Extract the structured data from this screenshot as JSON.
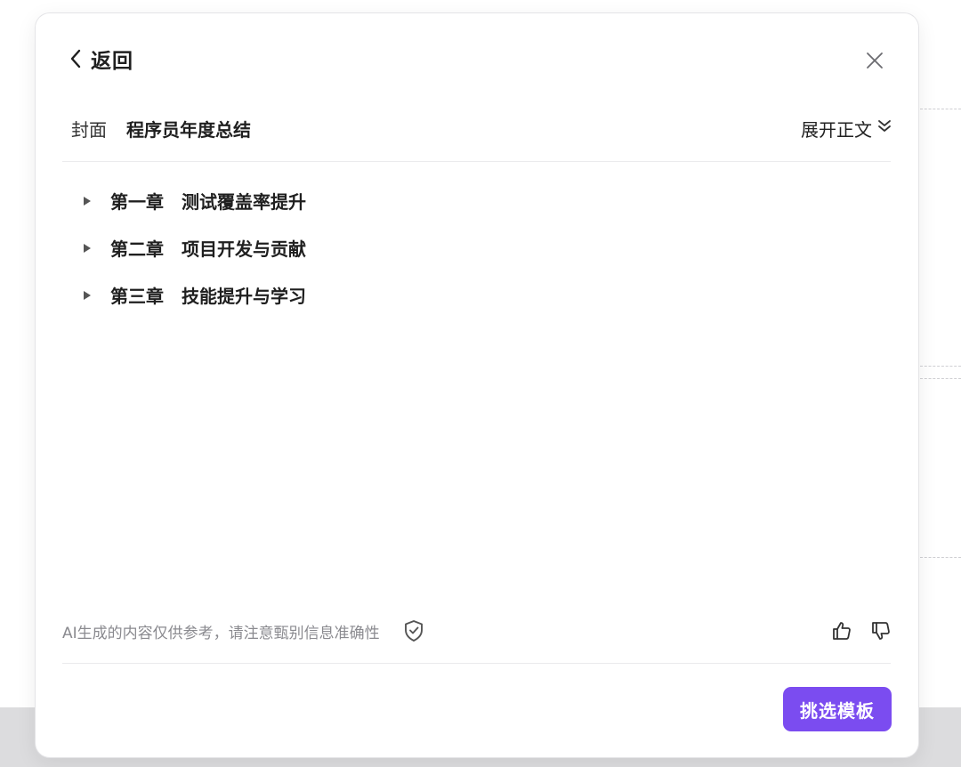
{
  "header": {
    "back_label": "返回"
  },
  "cover": {
    "label": "封面",
    "title": "程序员年度总结",
    "expand_label": "展开正文"
  },
  "chapters": [
    {
      "number": "第一章",
      "title": "测试覆盖率提升"
    },
    {
      "number": "第二章",
      "title": "项目开发与贡献"
    },
    {
      "number": "第三章",
      "title": "技能提升与学习"
    }
  ],
  "footer": {
    "disclaimer": "AI生成的内容仅供参考，请注意甄别信息准确性",
    "primary_button": "挑选模板"
  },
  "icons": {
    "back": "chevron-left-icon",
    "close": "close-icon",
    "expand": "double-chevron-down-icon",
    "shield": "shield-check-icon",
    "like": "thumbs-up-icon",
    "dislike": "thumbs-down-icon",
    "expand_chapter": "triangle-right-icon"
  },
  "colors": {
    "accent": "#7b4cf0",
    "muted_text": "#8a8a8f"
  }
}
